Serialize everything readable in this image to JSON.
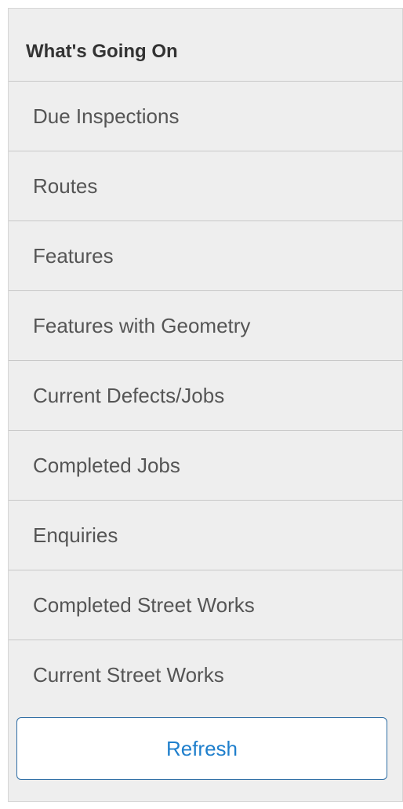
{
  "panel": {
    "title": "What's Going On",
    "items": [
      {
        "label": "Due Inspections"
      },
      {
        "label": "Routes"
      },
      {
        "label": "Features"
      },
      {
        "label": "Features with Geometry"
      },
      {
        "label": "Current Defects/Jobs"
      },
      {
        "label": "Completed Jobs"
      },
      {
        "label": "Enquiries"
      },
      {
        "label": "Completed Street Works"
      },
      {
        "label": "Current Street Works"
      }
    ],
    "refresh_label": "Refresh"
  },
  "colors": {
    "panel_background": "#eeeeee",
    "divider": "#c8c8c8",
    "text": "#555555",
    "title_text": "#333333",
    "button_border": "#2e6da4",
    "button_text": "#1f7fcc"
  }
}
